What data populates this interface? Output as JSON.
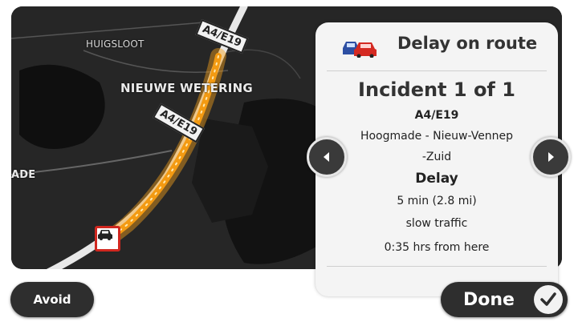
{
  "map": {
    "places": [
      "HUIGSLOOT",
      "NIEUWE WETERING",
      "ADE"
    ],
    "road_shields": [
      "A4/E19",
      "A4/E19"
    ]
  },
  "panel": {
    "title": "Delay on route",
    "incident_count": "Incident 1 of 1",
    "road": "A4/E19",
    "location_line1": "Hoogmade - Nieuw-Vennep",
    "location_line2": "-Zuid",
    "incident_type": "Delay",
    "delay": "5 min (2.8 mi)",
    "traffic": "slow traffic",
    "eta": "0:35 hrs from here"
  },
  "buttons": {
    "avoid": "Avoid",
    "done": "Done"
  },
  "icons": {
    "prev": "chevron-left-icon",
    "next": "chevron-right-icon",
    "car": "traffic-cars-icon",
    "check": "checkmark-icon"
  },
  "colors": {
    "route": "#f7a21c",
    "map_background": "#232323",
    "incident_red": "#d0271f"
  }
}
